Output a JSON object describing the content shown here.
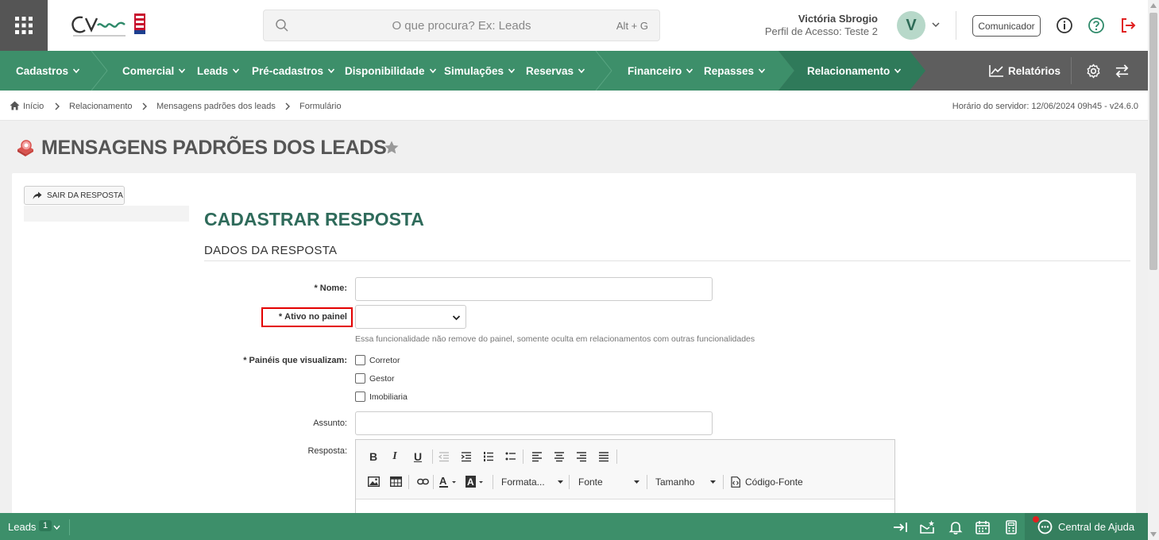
{
  "header": {
    "search_placeholder": "O que procura? Ex: Leads",
    "search_shortcut": "Alt + G",
    "user_name": "Victória Sbrogio",
    "user_profile": "Perfil de Acesso: Teste 2",
    "avatar_initial": "V",
    "comunicador_label": "Comunicador"
  },
  "nav": {
    "items": [
      {
        "label": "Cadastros"
      },
      {
        "label": "Comercial"
      },
      {
        "label": "Leads"
      },
      {
        "label": "Pré-cadastros"
      },
      {
        "label": "Disponibilidade"
      },
      {
        "label": "Simulações"
      },
      {
        "label": "Reservas"
      },
      {
        "label": "Financeiro"
      },
      {
        "label": "Repasses"
      },
      {
        "label": "Relacionamento"
      }
    ],
    "reports_label": "Relatórios",
    "colors": {
      "green": "#3d8f6a",
      "dark_green": "#2f7a5a",
      "gray": "#5e5e5e"
    }
  },
  "breadcrumb": {
    "items": [
      "Início",
      "Relacionamento",
      "Mensagens padrões dos leads",
      "Formulário"
    ],
    "server_time": "Horário do servidor: 12/06/2024 09h45 - v24.6.0"
  },
  "page": {
    "title": "MENSAGENS PADRÕES DOS LEADS",
    "exit_button": "SAIR DA RESPOSTA",
    "form_title": "CADASTRAR RESPOSTA",
    "section_title": "DADOS DA RESPOSTA"
  },
  "form": {
    "name_label": "Nome:",
    "active_label": "Ativo no painel",
    "active_value": "",
    "active_help": "Essa funcionalidade não remove do painel, somente oculta em relacionamentos com outras funcionalidades",
    "panels_label": "Painéis que visualizam:",
    "panels": [
      {
        "label": "Corretor",
        "checked": false
      },
      {
        "label": "Gestor",
        "checked": false
      },
      {
        "label": "Imobiliaria",
        "checked": false
      }
    ],
    "subject_label": "Assunto:",
    "response_label": "Resposta:",
    "required_mark": "*"
  },
  "editor": {
    "format_label": "Formata...",
    "font_label": "Fonte",
    "size_label": "Tamanho",
    "source_label": "Código-Fonte"
  },
  "bottom": {
    "leads_label": "Leads",
    "leads_count": "1",
    "help_center": "Central de Ajuda"
  }
}
